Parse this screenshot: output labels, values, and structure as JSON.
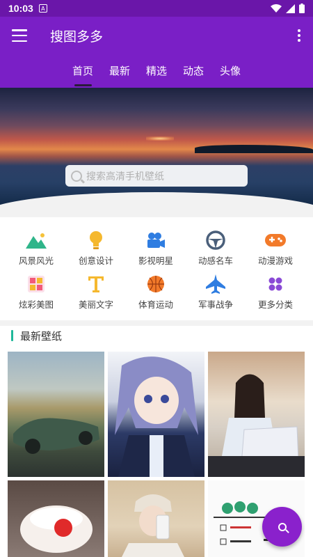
{
  "status": {
    "time": "10:03"
  },
  "appbar": {
    "title": "搜图多多"
  },
  "tabs": [
    {
      "label": "首页",
      "active": true
    },
    {
      "label": "最新",
      "active": false
    },
    {
      "label": "精选",
      "active": false
    },
    {
      "label": "动态",
      "active": false
    },
    {
      "label": "头像",
      "active": false
    }
  ],
  "search": {
    "placeholder": "搜索高清手机壁纸"
  },
  "categories": [
    {
      "label": "风景风光",
      "icon": "mountain-icon",
      "color": "#2fb58a"
    },
    {
      "label": "创意设计",
      "icon": "lightbulb-icon",
      "color": "#f5b82e"
    },
    {
      "label": "影视明星",
      "icon": "video-camera-icon",
      "color": "#2f7de1"
    },
    {
      "label": "动感名车",
      "icon": "steering-wheel-icon",
      "color": "#4a5f7a"
    },
    {
      "label": "动漫游戏",
      "icon": "gamepad-icon",
      "color": "#f27a2a"
    },
    {
      "label": "炫彩美图",
      "icon": "color-palette-icon",
      "color": "#f25a7a"
    },
    {
      "label": "美丽文字",
      "icon": "text-t-icon",
      "color": "#f5b82e"
    },
    {
      "label": "体育运动",
      "icon": "basketball-icon",
      "color": "#f27a2a"
    },
    {
      "label": "军事战争",
      "icon": "fighter-jet-icon",
      "color": "#2f7de1"
    },
    {
      "label": "更多分类",
      "icon": "grid-dots-icon",
      "color": "#8a4ad6"
    }
  ],
  "section": {
    "title": "最新壁纸"
  },
  "colors": {
    "primary": "#7a1fc6",
    "status": "#6a16a9",
    "accent": "#1fb89a",
    "fab": "#8a21cc"
  }
}
